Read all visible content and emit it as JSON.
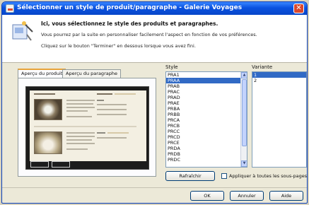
{
  "window": {
    "title": "Sélectionner un style de produit/paragraphe - Galerie Voyages"
  },
  "header": {
    "title": "Ici, vous sélectionnez le style des produits et paragraphes.",
    "line1": "Vous pourrez par la suite en personnaliser facilement l'aspect en fonction de vos préférences.",
    "line2": "Cliquez sur le bouton \"Terminer\" en dessous lorsque vous avez fini."
  },
  "tabs": [
    {
      "label": "Aperçu du produit",
      "active": true
    },
    {
      "label": "Aperçu du paragraphe",
      "active": false
    }
  ],
  "style": {
    "label": "Style",
    "items": [
      "PRA1",
      "PRAA",
      "PRAB",
      "PRAC",
      "PRAD",
      "PRAE",
      "PRBA",
      "PRBB",
      "PRCA",
      "PRCB",
      "PRCC",
      "PRCD",
      "PRCE",
      "PRDA",
      "PRDB",
      "PRDC"
    ],
    "selected": "PRAA"
  },
  "variant": {
    "label": "Variante",
    "items": [
      "1",
      "2"
    ],
    "selected": "1"
  },
  "buttons": {
    "refresh": "Rafraîchir",
    "ok": "OK",
    "cancel": "Annuler",
    "help": "Aide"
  },
  "checkbox": {
    "label": "Appliquer à toutes les sous-pages",
    "checked": false
  },
  "colors": {
    "titlebar": "#0a52e0",
    "selection": "#316ac5",
    "dialog_bg": "#ece9d8"
  }
}
